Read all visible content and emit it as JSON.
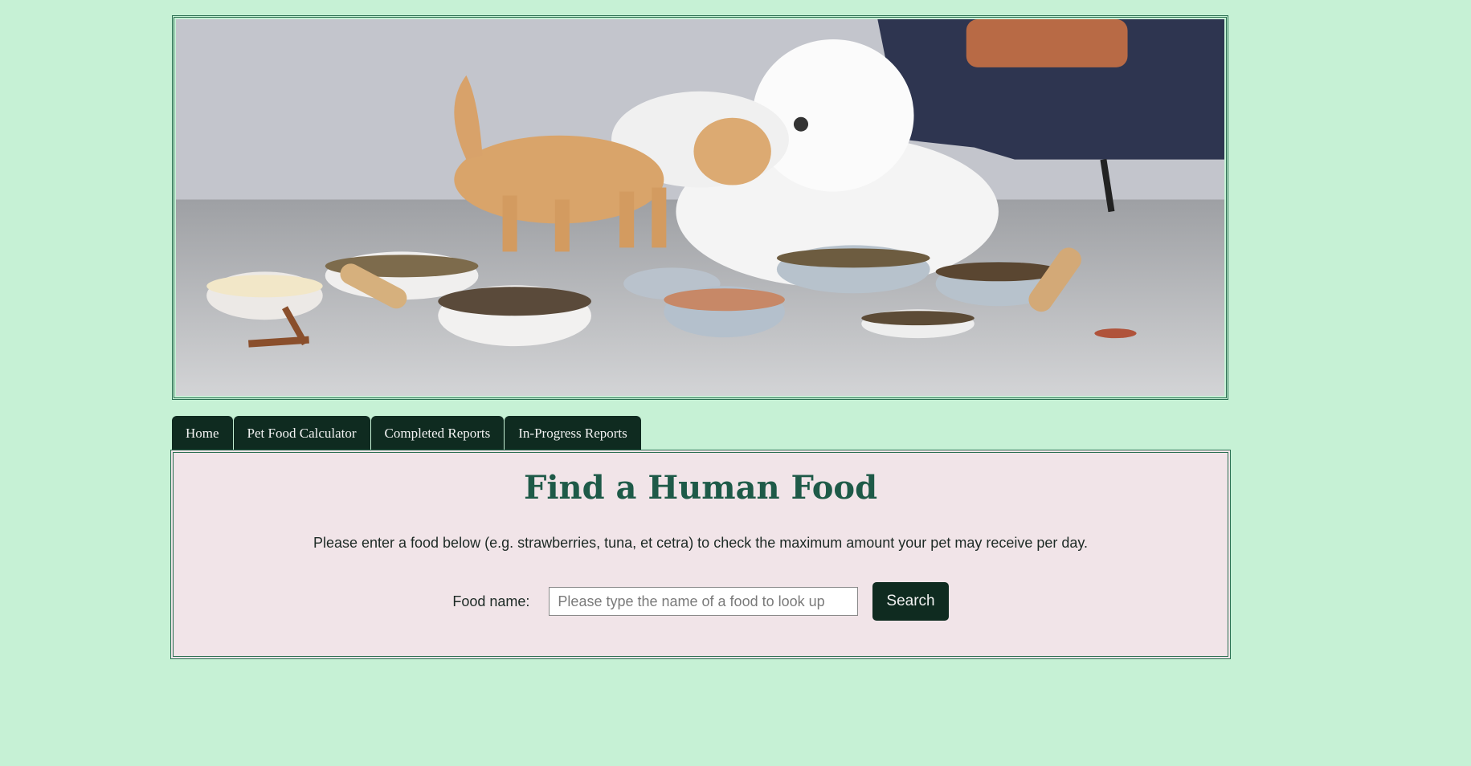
{
  "banner": {
    "image_description_icon": "pets-food-banner-image"
  },
  "nav": {
    "tabs": [
      {
        "label": "Home"
      },
      {
        "label": "Pet Food Calculator"
      },
      {
        "label": "Completed Reports"
      },
      {
        "label": "In-Progress Reports"
      }
    ]
  },
  "main": {
    "title": "Find a Human Food",
    "description": "Please enter a food below (e.g. strawberries, tuna, et cetra) to check the maximum amount your pet may receive per day.",
    "food_label": "Food name:",
    "food_input": {
      "value": "",
      "placeholder": "Please type the name of a food to look up"
    },
    "search_label": "Search"
  },
  "colors": {
    "background": "#c6f1d5",
    "accent_dark": "#0f2b20",
    "title_green": "#1e5a48",
    "panel_bg": "#f1e4e8",
    "border": "#2b6f52"
  }
}
